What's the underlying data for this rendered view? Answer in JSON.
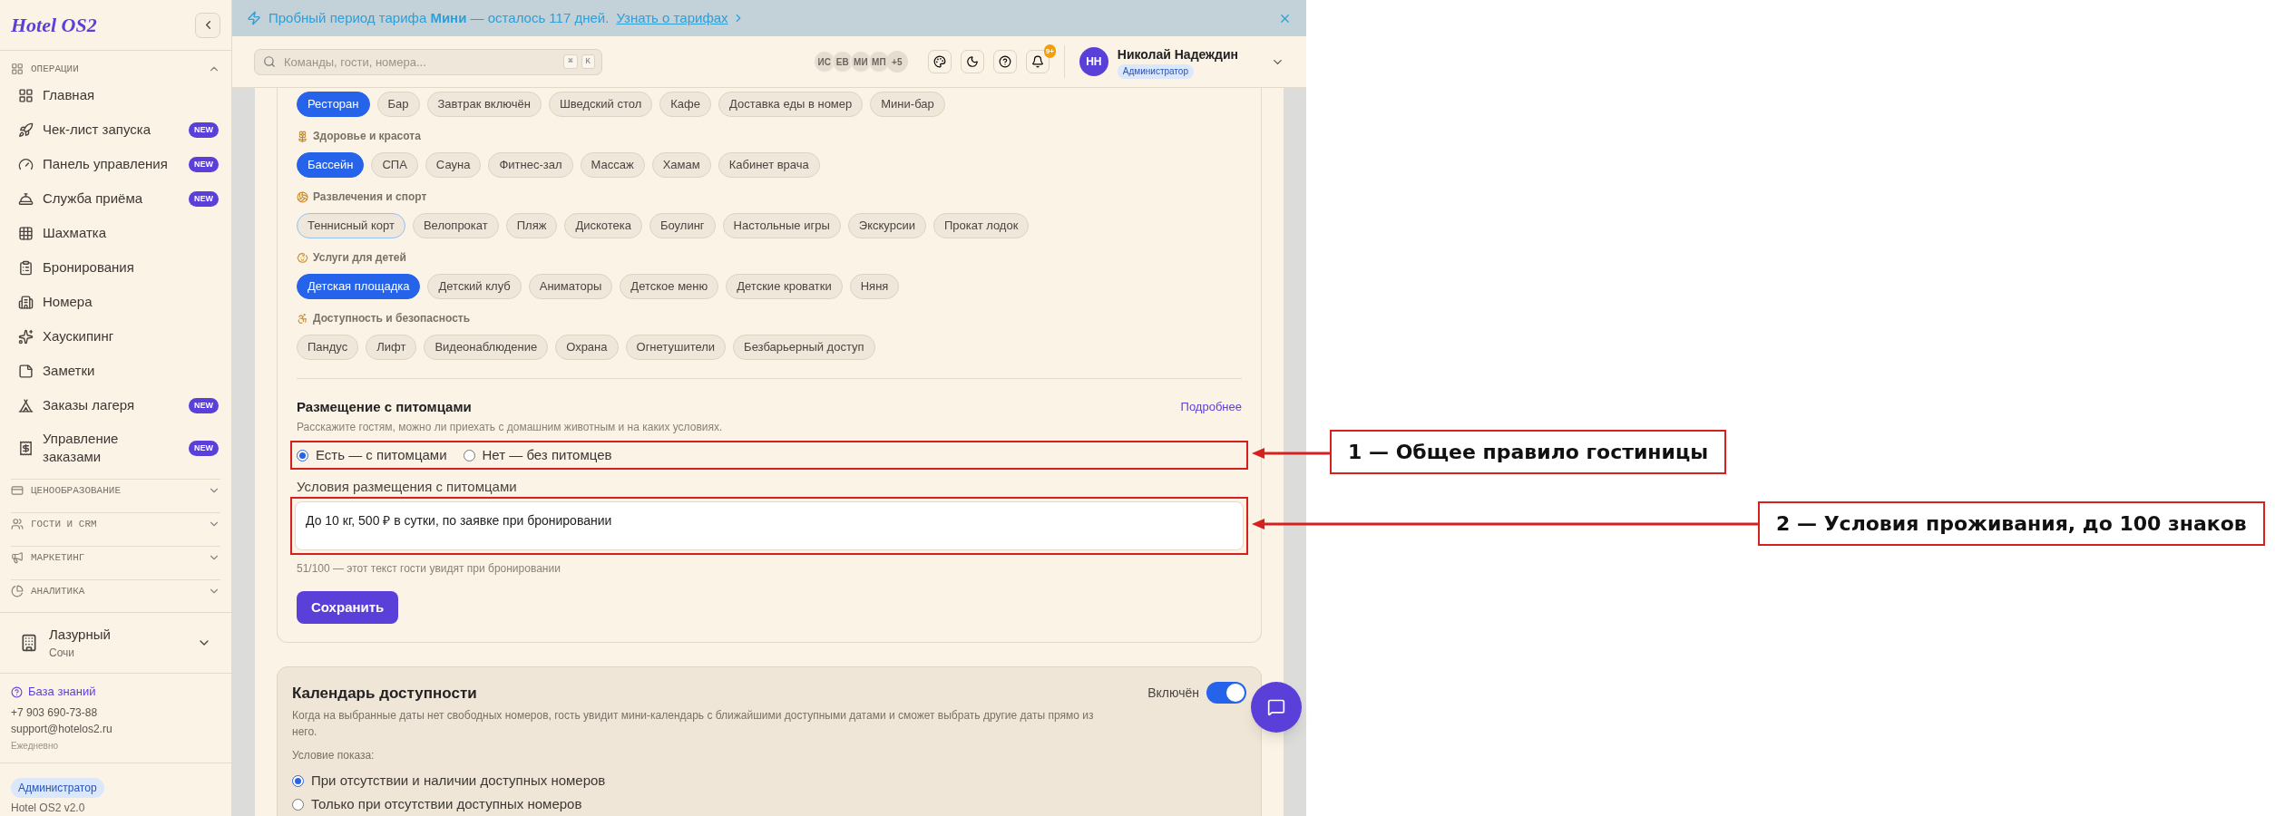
{
  "sidebar": {
    "logo": "Hotel OS2",
    "sections": [
      {
        "label": "ОПЕРАЦИИ",
        "kind": "operations",
        "expanded": true,
        "items": [
          {
            "label": "Главная",
            "kind": "home"
          },
          {
            "label": "Чек-лист запуска",
            "kind": "launch",
            "badge": "NEW"
          },
          {
            "label": "Панель управления",
            "kind": "dashboard",
            "badge": "NEW"
          },
          {
            "label": "Служба приёма",
            "kind": "frontdesk",
            "badge": "NEW"
          },
          {
            "label": "Шахматка",
            "kind": "grid"
          },
          {
            "label": "Бронирования",
            "kind": "bookings"
          },
          {
            "label": "Номера",
            "kind": "rooms"
          },
          {
            "label": "Хаускипинг",
            "kind": "housekeeping"
          },
          {
            "label": "Заметки",
            "kind": "notes"
          },
          {
            "label": "Заказы лагеря",
            "kind": "camp",
            "badge": "NEW"
          },
          {
            "label": "Управление заказами",
            "kind": "orders",
            "badge": "NEW"
          }
        ]
      },
      {
        "label": "ЦЕНООБРАЗОВАНИЕ",
        "kind": "pricing",
        "expanded": false
      },
      {
        "label": "ГОСТИ И CRM",
        "kind": "guests",
        "expanded": false
      },
      {
        "label": "МАРКЕТИНГ",
        "kind": "marketing",
        "expanded": false
      },
      {
        "label": "АНАЛИТИКА",
        "kind": "analytics",
        "expanded": false
      }
    ],
    "hotel": {
      "name": "Лазурный",
      "city": "Сочи"
    },
    "help_link": "База знаний",
    "phone": "+7 903 690-73-88",
    "email": "support@hotelos2.ru",
    "hours": "Ежедневно",
    "role": "Администратор",
    "version": "Hotel OS2 v2.0"
  },
  "banner": {
    "text": "Пробный период тарифа **Мини** — осталось 117 дней.",
    "link": "Узнать о тарифах"
  },
  "header": {
    "search": {
      "placeholder": "Команды, гости, номера..."
    },
    "shortcut": [
      "⌘",
      "K"
    ],
    "team": [
      "ИС",
      "ЕВ",
      "МИ",
      "МП"
    ],
    "team_more": "+5",
    "notifications": "9+",
    "user": {
      "initials": "НН",
      "name": "Николай Надеждин",
      "role": "Администратор"
    }
  },
  "categories": [
    {
      "kind": "food",
      "chips": [
        {
          "label": "Ресторан",
          "selected": true,
          "focused": false
        },
        {
          "label": "Бар",
          "selected": false,
          "focused": false
        },
        {
          "label": "Завтрак включён",
          "selected": false,
          "focused": false
        },
        {
          "label": "Шведский стол",
          "selected": false,
          "focused": false
        },
        {
          "label": "Кафе",
          "selected": false,
          "focused": false
        },
        {
          "label": "Доставка еды в номер",
          "selected": false,
          "focused": false
        },
        {
          "label": "Мини-бар",
          "selected": false,
          "focused": false
        }
      ]
    },
    {
      "kind": "health",
      "title": "Здоровье и красота",
      "chips": [
        {
          "label": "Бассейн",
          "selected": true,
          "focused": false
        },
        {
          "label": "СПА",
          "selected": false,
          "focused": false
        },
        {
          "label": "Сауна",
          "selected": false,
          "focused": false
        },
        {
          "label": "Фитнес-зал",
          "selected": false,
          "focused": false
        },
        {
          "label": "Массаж",
          "selected": false,
          "focused": false
        },
        {
          "label": "Хамам",
          "selected": false,
          "focused": false
        },
        {
          "label": "Кабинет врача",
          "selected": false,
          "focused": false
        }
      ]
    },
    {
      "kind": "sport",
      "title": "Развлечения и спорт",
      "chips": [
        {
          "label": "Теннисный корт",
          "selected": false,
          "focused": true
        },
        {
          "label": "Велопрокат",
          "selected": false,
          "focused": false
        },
        {
          "label": "Пляж",
          "selected": false,
          "focused": false
        },
        {
          "label": "Дискотека",
          "selected": false,
          "focused": false
        },
        {
          "label": "Боулинг",
          "selected": false,
          "focused": false
        },
        {
          "label": "Настольные игры",
          "selected": false,
          "focused": false
        },
        {
          "label": "Экскурсии",
          "selected": false,
          "focused": false
        },
        {
          "label": "Прокат лодок",
          "selected": false,
          "focused": false
        }
      ]
    },
    {
      "kind": "kids",
      "title": "Услуги для детей",
      "chips": [
        {
          "label": "Детская площадка",
          "selected": true,
          "focused": false
        },
        {
          "label": "Детский клуб",
          "selected": false,
          "focused": false
        },
        {
          "label": "Аниматоры",
          "selected": false,
          "focused": false
        },
        {
          "label": "Детское меню",
          "selected": false,
          "focused": false
        },
        {
          "label": "Детские кроватки",
          "selected": false,
          "focused": false
        },
        {
          "label": "Няня",
          "selected": false,
          "focused": false
        }
      ]
    },
    {
      "kind": "access",
      "title": "Доступность и безопасность",
      "chips": [
        {
          "label": "Пандус",
          "selected": false,
          "focused": false
        },
        {
          "label": "Лифт",
          "selected": false,
          "focused": false
        },
        {
          "label": "Видеонаблюдение",
          "selected": false,
          "focused": false
        },
        {
          "label": "Охрана",
          "selected": false,
          "focused": false
        },
        {
          "label": "Огнетушители",
          "selected": false,
          "focused": false
        },
        {
          "label": "Безбарьерный доступ",
          "selected": false,
          "focused": false
        }
      ]
    }
  ],
  "pets": {
    "title": "Размещение с питомцами",
    "link": "Подробнее",
    "description": "Расскажите гостям, можно ли приехать с домашним животным и на каких условиях.",
    "options": [
      {
        "label": "Есть — с питомцами",
        "selected": true
      },
      {
        "label": "Нет — без питомцев",
        "selected": false
      }
    ],
    "field_label": "Условия размещения с питомцами",
    "value": "До 10 кг, 500 ₽ в сутки, по заявке при бронировании",
    "hint": "51/100 — этот текст гости увидят при бронировании",
    "save": "Сохранить"
  },
  "calendar": {
    "title": "Календарь доступности",
    "description": "Когда на выбранные даты нет свободных номеров, гость увидит мини-календарь с ближайшими доступными датами и сможет выбрать другие даты прямо из него.",
    "toggle_label": "Включён",
    "on": true,
    "condition_label": "Условие показа:",
    "options": [
      {
        "label": "При отсутствии и наличии доступных номеров",
        "selected": true
      },
      {
        "label": "Только при отсутствии доступных номеров",
        "selected": false
      }
    ]
  },
  "annotations": [
    "1 — Общее правило гостиницы",
    "2 — Условия проживания, до 100 знаков"
  ]
}
